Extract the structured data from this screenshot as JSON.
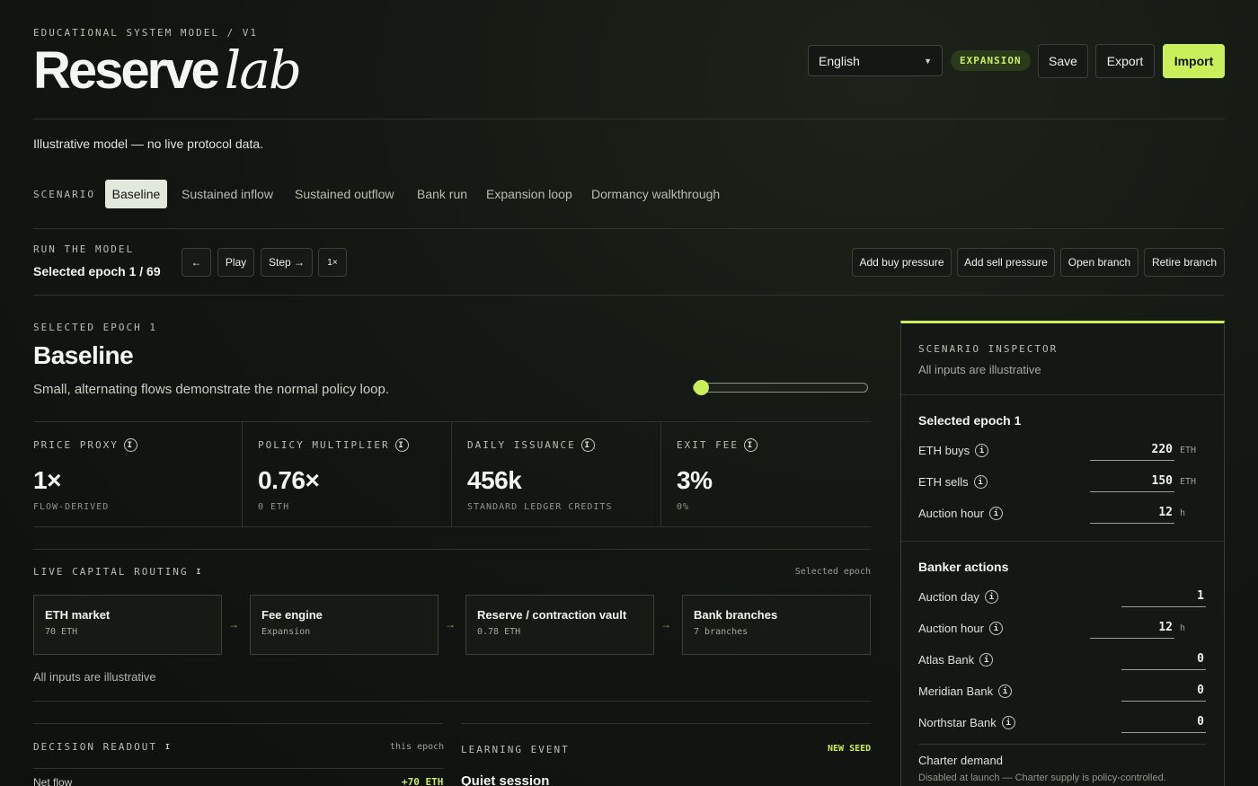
{
  "header": {
    "eyebrow": "EDUCATIONAL SYSTEM MODEL / V1",
    "title_main": "Reserve",
    "title_italic": "lab",
    "language": "English",
    "mode_badge": "EXPANSION",
    "save_label": "Save",
    "export_label": "Export",
    "import_label": "Import"
  },
  "disclaimer": "Illustrative model — no live protocol data.",
  "scenario": {
    "label": "SCENARIO",
    "tabs": [
      "Baseline",
      "Sustained inflow",
      "Sustained outflow",
      "Bank run",
      "Expansion loop",
      "Dormancy walkthrough"
    ],
    "active": "Baseline"
  },
  "run": {
    "label": "RUN THE MODEL",
    "selected": "Selected epoch 1 / 69",
    "back_label": "←",
    "play_label": "Play",
    "step_label": "Step →",
    "speed_label": "1×",
    "actions": [
      "Add buy pressure",
      "Add sell pressure",
      "Open branch",
      "Retire branch"
    ]
  },
  "epoch": {
    "eyebrow": "SELECTED EPOCH 1",
    "title": "Baseline",
    "description": "Small, alternating flows demonstrate the normal policy loop.",
    "slider_position": 0.0
  },
  "metrics": [
    {
      "label": "PRICE PROXY",
      "value": "1×",
      "sub": "FLOW-DERIVED"
    },
    {
      "label": "POLICY MULTIPLIER",
      "value": "0.76×",
      "sub": "0 ETH"
    },
    {
      "label": "DAILY ISSUANCE",
      "value": "456k",
      "sub": "STANDARD LEDGER CREDITS"
    },
    {
      "label": "EXIT FEE",
      "value": "3%",
      "sub": "0%"
    }
  ],
  "routing": {
    "label": "LIVE CAPITAL ROUTING",
    "right_label": "Selected epoch",
    "nodes": [
      {
        "title": "ETH market",
        "sub": "70 ETH"
      },
      {
        "title": "Fee engine",
        "sub": "Expansion"
      },
      {
        "title": "Reserve / contraction vault",
        "sub": "0.78 ETH"
      },
      {
        "title": "Bank branches",
        "sub": "7 branches"
      }
    ],
    "arrow": "→",
    "footnote": "All inputs are illustrative"
  },
  "decision": {
    "label": "DECISION READOUT",
    "right_label": "this epoch",
    "row_label": "Net flow",
    "row_value": "+70 ETH"
  },
  "learning": {
    "label": "LEARNING EVENT",
    "right_label": "NEW SEED",
    "title": "Quiet session"
  },
  "inspector": {
    "eyebrow": "SCENARIO INSPECTOR",
    "subtitle": "All inputs are illustrative",
    "section1_title": "Selected epoch 1",
    "section1_rows": [
      {
        "label": "ETH buys",
        "value": "220",
        "unit": "ETH"
      },
      {
        "label": "ETH sells",
        "value": "150",
        "unit": "ETH"
      },
      {
        "label": "Auction hour",
        "value": "12",
        "unit": "h"
      }
    ],
    "section2_title": "Banker actions",
    "section2_rows": [
      {
        "label": "Auction day",
        "value": "1",
        "unit": ""
      },
      {
        "label": "Auction hour",
        "value": "12",
        "unit": "h"
      },
      {
        "label": "Atlas Bank",
        "value": "0",
        "unit": ""
      },
      {
        "label": "Meridian Bank",
        "value": "0",
        "unit": ""
      },
      {
        "label": "Northstar Bank",
        "value": "0",
        "unit": ""
      }
    ],
    "charter_title": "Charter demand",
    "charter_note": "Disabled at launch — Charter supply is policy-controlled."
  },
  "colors": {
    "accent": "#c9ef5a",
    "background": "#121511",
    "border": "#2f342c"
  }
}
